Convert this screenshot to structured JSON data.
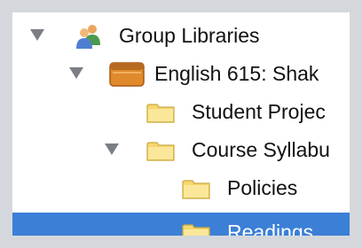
{
  "tree": {
    "items": [
      {
        "label": "Group Libraries",
        "expanded": true,
        "icon": "group-users-icon"
      },
      {
        "label": "English 615: Shak",
        "expanded": true,
        "icon": "library-box-icon"
      },
      {
        "label": "Student Projec",
        "icon": "folder-icon"
      },
      {
        "label": "Course Syllabu",
        "expanded": true,
        "icon": "folder-icon"
      },
      {
        "label": "Policies",
        "icon": "folder-icon"
      },
      {
        "label": "Readings",
        "icon": "folder-icon",
        "selected": true
      }
    ]
  },
  "colors": {
    "selection": "#3b7fd6",
    "folder": "#f6d76f",
    "library_box": "#e08a2c",
    "background": "#d4d8dd"
  }
}
